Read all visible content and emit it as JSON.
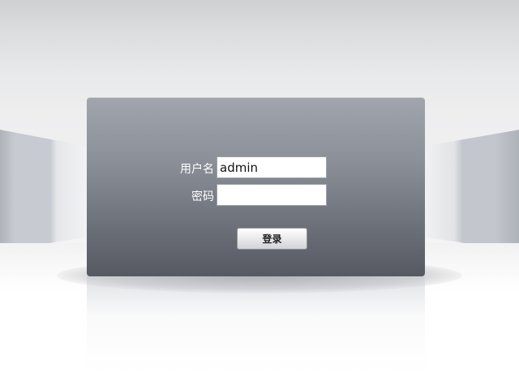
{
  "login_form": {
    "username_label": "用户名",
    "username_value": "admin",
    "username_placeholder": "",
    "password_label": "密码",
    "password_value": "",
    "password_placeholder": "",
    "submit_label": "登录"
  },
  "colors": {
    "panel_top": "#a1a5ad",
    "panel_bottom": "#565962",
    "label_text": "#ffffff",
    "input_background": "#ffffff"
  }
}
